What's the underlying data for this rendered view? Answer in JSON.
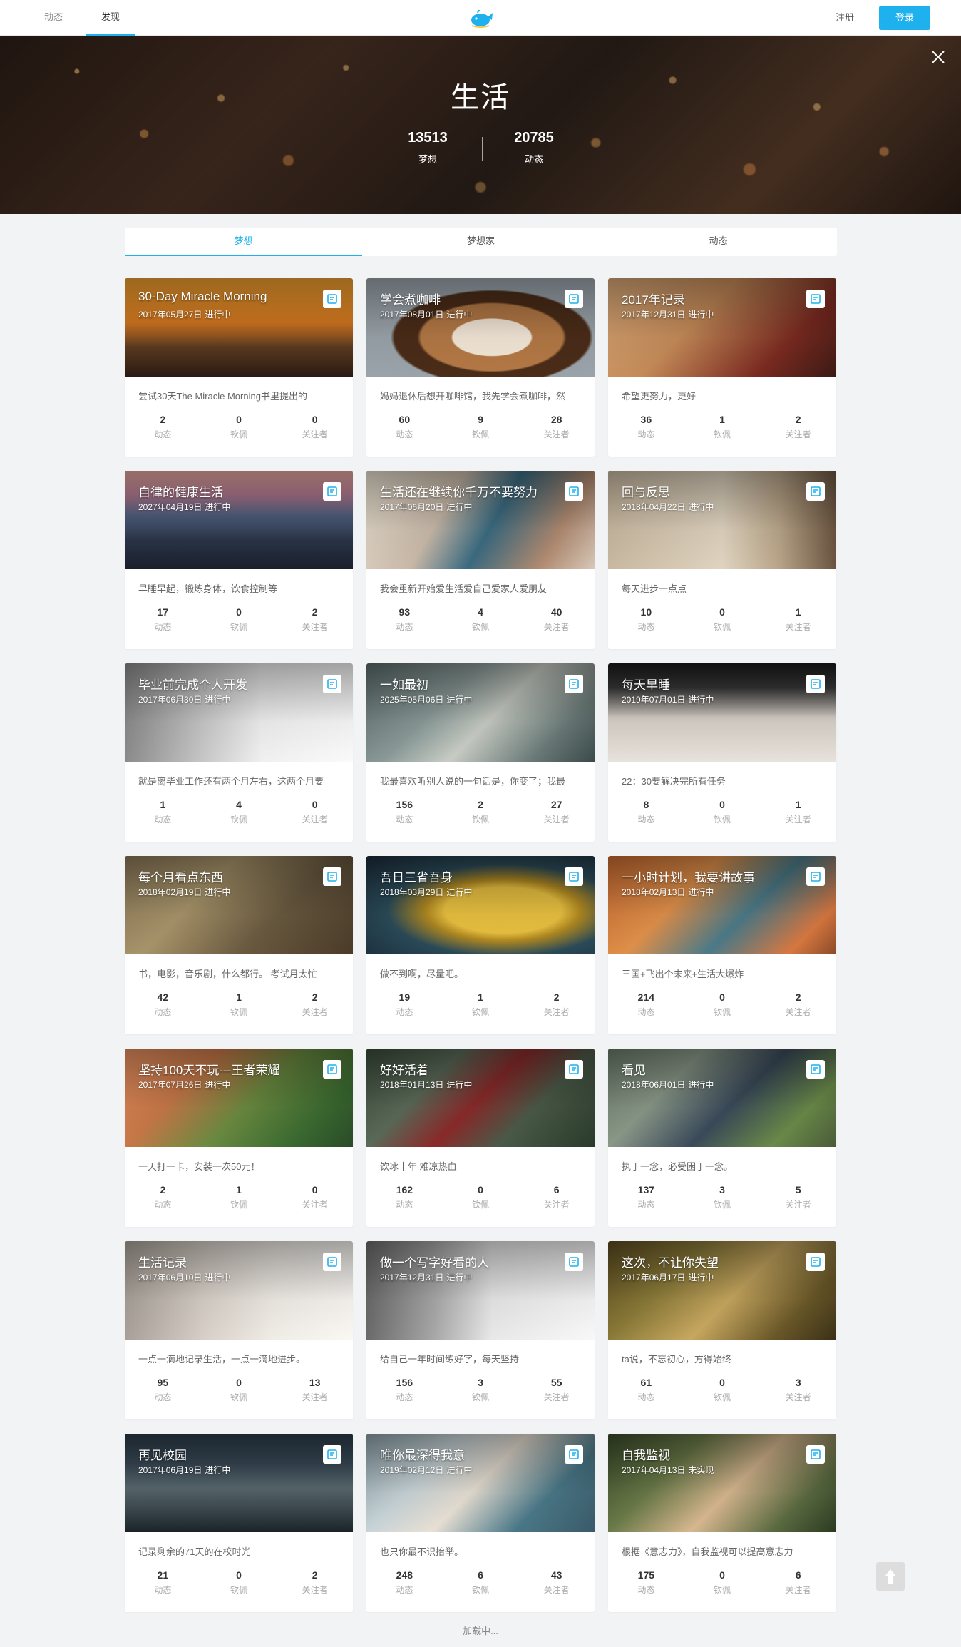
{
  "topbar": {
    "nav": [
      "动态",
      "发现"
    ],
    "register": "注册",
    "login": "登录"
  },
  "hero": {
    "title": "生活",
    "stats": [
      {
        "num": "13513",
        "label": "梦想"
      },
      {
        "num": "20785",
        "label": "动态"
      }
    ]
  },
  "tabs": [
    "梦想",
    "梦想家",
    "动态"
  ],
  "stat_labels": [
    "动态",
    "钦佩",
    "关注者"
  ],
  "cards": [
    {
      "title": "30-Day Miracle Morning",
      "date": "2017年05月27日",
      "status": "进行中",
      "desc": "尝试30天The Miracle Morning书里提出的",
      "stats": [
        "2",
        "0",
        "0"
      ],
      "bg": "linear-gradient(180deg,#f0a030 0%,#d97a20 45%,#5a3a20 70%,#2a1a12 100%)"
    },
    {
      "title": "学会煮咖啡",
      "date": "2017年08月01日",
      "status": "进行中",
      "desc": "妈妈退休后想开咖啡馆，我先学会煮咖啡，然",
      "stats": [
        "60",
        "9",
        "28"
      ],
      "bg": "radial-gradient(ellipse at 55% 60%,#f2e6d6 0 22%,#b37845 23% 40%,#4a2c18 42% 55%,#9aa3aa 57% 100%)"
    },
    {
      "title": "2017年记录",
      "date": "2017年12月31日",
      "status": "进行中",
      "desc": "希望更努力，更好",
      "stats": [
        "36",
        "1",
        "2"
      ],
      "bg": "linear-gradient(135deg,#d8a878 0%,#c48a58 40%,#7a2a20 75%,#3a1a14 100%)"
    },
    {
      "title": "自律的健康生活",
      "date": "2027年04月19日",
      "status": "进行中",
      "desc": "早睡早起，锻炼身体，饮食控制等",
      "stats": [
        "17",
        "0",
        "2"
      ],
      "bg": "linear-gradient(180deg,#e8a8a0 0%,#b07890 25%,#506080 45%,#2a3548 70%,#1a1f2a 100%)"
    },
    {
      "title": "生活还在继续你千万不要努力",
      "date": "2017年06月20日",
      "status": "进行中",
      "desc": "我会重新开始爱生活爱自己爱家人爱朋友",
      "stats": [
        "93",
        "4",
        "40"
      ],
      "bg": "linear-gradient(120deg,#e8e0d0 0%,#c8b8a8 35%,#3a6a80 55%,#b08a70 80%,#d8c8b8 100%)"
    },
    {
      "title": "回与反思",
      "date": "2018年04月22日",
      "status": "进行中",
      "desc": "每天进步一点点",
      "stats": [
        "10",
        "0",
        "1"
      ],
      "bg": "linear-gradient(90deg,#c8b8a0 0%,#e0d4c0 50%,#b8a488 75%,#6a5440 100%)"
    },
    {
      "title": "毕业前完成个人开发",
      "date": "2017年06月30日",
      "status": "进行中",
      "desc": "就是离毕业工作还有两个月左右，这两个月要",
      "stats": [
        "1",
        "4",
        "0"
      ],
      "bg": "linear-gradient(90deg,#8a8a8a 0%,#c8c8c8 35%,#f0f0f0 60%,#fafafa 100%)"
    },
    {
      "title": "一如最初",
      "date": "2025年05月06日",
      "status": "进行中",
      "desc": "我最喜欢听别人说的一句话是，你变了；我最",
      "stats": [
        "156",
        "2",
        "27"
      ],
      "bg": "linear-gradient(135deg,#5a6a6a 0%,#8a9a98 35%,#c8ccc4 55%,#6a7a78 80%,#3a4a4a 100%)"
    },
    {
      "title": "每天早睡",
      "date": "2019年07月01日",
      "status": "进行中",
      "desc": "22：30要解决完所有任务",
      "stats": [
        "8",
        "0",
        "1"
      ],
      "bg": "linear-gradient(180deg,#1a1a1a 0%,#3a3a3a 25%,#d8d0c8 55%,#e8e2dc 100%)"
    },
    {
      "title": "每个月看点东西",
      "date": "2018年02月19日",
      "status": "进行中",
      "desc": "书，电影，音乐剧，什么都行。 考试月太忙",
      "stats": [
        "42",
        "1",
        "2"
      ],
      "bg": "linear-gradient(135deg,#8a7858 0%,#a8946a 35%,#6a5a40 65%,#4a3a28 100%)"
    },
    {
      "title": "吾日三省吾身",
      "date": "2018年03月29日",
      "status": "进行中",
      "desc": "做不到啊，尽量吧。",
      "stats": [
        "19",
        "1",
        "2"
      ],
      "bg": "radial-gradient(ellipse at 60% 55%,#e8c040 0 30%,#b08820 40%,#2a4a58 60%,#1a2a38 100%)"
    },
    {
      "title": "一小时计划，我要讲故事",
      "date": "2018年02月13日",
      "status": "进行中",
      "desc": "三国+飞出个未来+生活大爆炸",
      "stats": [
        "214",
        "0",
        "2"
      ],
      "bg": "linear-gradient(135deg,#c86a30 0%,#e0904a 35%,#4a7a88 60%,#d87840 85%,#8a4a28 100%)"
    },
    {
      "title": "坚持100天不玩---王者荣耀",
      "date": "2017年07月26日",
      "status": "进行中",
      "desc": "一天打一卡，安装一次50元！",
      "stats": [
        "2",
        "1",
        "0"
      ],
      "bg": "linear-gradient(135deg,#e89060 0%,#c87848 30%,#6a8a40 55%,#3a6a30 80%,#2a4a28 100%)"
    },
    {
      "title": "好好活着",
      "date": "2018年01月13日",
      "status": "进行中",
      "desc": "饮冰十年 难凉热血",
      "stats": [
        "162",
        "0",
        "6"
      ],
      "bg": "linear-gradient(135deg,#3a4a3a 0%,#5a6a58 30%,#8a2a2a 50%,#4a5a48 70%,#2a3a2a 100%)"
    },
    {
      "title": "看见",
      "date": "2018年06月01日",
      "status": "进行中",
      "desc": "执于一念，必受困于一念。",
      "stats": [
        "137",
        "3",
        "5"
      ],
      "bg": "linear-gradient(135deg,#6a7a6a 0%,#8a9888 30%,#3a4a5a 55%,#6a8a48 80%,#4a5a3a 100%)"
    },
    {
      "title": "生活记录",
      "date": "2017年06月10日",
      "status": "进行中",
      "desc": "一点一滴地记录生活，一点一滴地进步。",
      "stats": [
        "95",
        "0",
        "13"
      ],
      "bg": "linear-gradient(90deg,#a8a098 0%,#d8d0c8 35%,#f0ece6 65%,#fbf8f4 100%)"
    },
    {
      "title": "做一个写字好看的人",
      "date": "2017年12月31日",
      "status": "进行中",
      "desc": "给自己一年时间练好字，每天坚持",
      "stats": [
        "156",
        "3",
        "55"
      ],
      "bg": "linear-gradient(90deg,#6a6a6a 0%,#a8a8a8 30%,#e8e8e8 55%,#f8f8f8 100%)"
    },
    {
      "title": "这次，不让你失望",
      "date": "2017年06月17日",
      "status": "进行中",
      "desc": "ta说，不忘初心，方得始终",
      "stats": [
        "61",
        "0",
        "3"
      ],
      "bg": "linear-gradient(135deg,#5a4a20 0%,#8a7a38 30%,#c8a860 55%,#6a5828 80%,#3a3018 100%)"
    },
    {
      "title": "再见校园",
      "date": "2017年06月19日",
      "status": "进行中",
      "desc": "记录剩余的71天的在校时光",
      "stats": [
        "21",
        "0",
        "2"
      ],
      "bg": "linear-gradient(180deg,#2a3a48 0%,#3a4a58 30%,#5a6a70 55%,#1a2428 100%)"
    },
    {
      "title": "唯你最深得我意",
      "date": "2019年02月12日",
      "status": "进行中",
      "desc": "也只你最不识抬举。",
      "stats": [
        "248",
        "6",
        "43"
      ],
      "bg": "linear-gradient(135deg,#8aa0a8 0%,#c8d4d8 30%,#e8e0d4 50%,#4a7888 75%,#3a5a68 100%)"
    },
    {
      "title": "自我监视",
      "date": "2017年04月13日",
      "status": "未实现",
      "desc": "根据《意志力》，自我监视可以提高意志力",
      "stats": [
        "175",
        "0",
        "6"
      ],
      "bg": "linear-gradient(135deg,#3a4a2a 0%,#6a7a48 30%,#d8b890 55%,#5a6a40 80%,#2a3a20 100%)"
    }
  ],
  "loading": "加载中...",
  "colors": {
    "accent": "#1eb1ee",
    "page_bg": "#f2f3f5"
  }
}
